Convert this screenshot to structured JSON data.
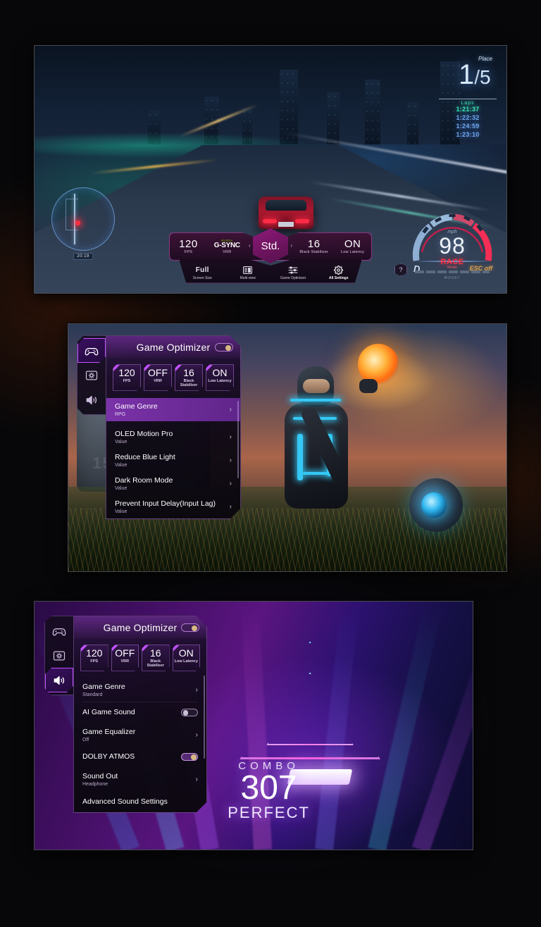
{
  "panels": {
    "racing": {
      "name": "Racing game with Game Bar HUD",
      "hud": {
        "place_label": "Place",
        "place_value": "1",
        "place_total": "5",
        "laps_label": "Laps",
        "lap_times": [
          "1:21:37",
          "1:22:32",
          "1:24:59",
          "1:23:10"
        ],
        "minimap_label": "20:19"
      },
      "speedometer": {
        "unit": "mph",
        "speed": "98",
        "mode_name": "RACE",
        "mode_sub": "Mode",
        "gear": "D",
        "esc": "ESC off",
        "boost_label": "BOOST"
      },
      "game_bar": {
        "stats": [
          {
            "value": "120",
            "label": "FPS"
          },
          {
            "value": "G-SYNC",
            "label": "VRR",
            "brand": "NVIDIA"
          },
          {
            "value": "16",
            "label": "Black Stabilizer"
          },
          {
            "value": "ON",
            "label": "Low Latency"
          }
        ],
        "center_mode": "Std.",
        "arrow_left": "‹",
        "arrow_right": "›",
        "actions": [
          {
            "icon": "screen-size-icon",
            "value": "Full",
            "label": "Screen Size"
          },
          {
            "icon": "multi-view-icon",
            "value": "",
            "label": "Multi-view"
          },
          {
            "icon": "sliders-icon",
            "value": "",
            "label": "Game Optimizer"
          },
          {
            "icon": "gear-icon",
            "value": "",
            "label": "All Settings"
          }
        ],
        "help": "?"
      }
    },
    "scifi": {
      "name": "Sci-fi game with Game Optimizer menu",
      "osd": {
        "title": "Game Optimizer",
        "rail": [
          {
            "icon": "gamepad-icon",
            "name": "game-tab",
            "active": true
          },
          {
            "icon": "picture-icon",
            "name": "picture-tab",
            "active": false
          },
          {
            "icon": "speaker-icon",
            "name": "sound-tab",
            "active": false
          }
        ],
        "chips": [
          {
            "value": "120",
            "label": "FPS"
          },
          {
            "value": "OFF",
            "label": "VRR"
          },
          {
            "value": "16",
            "label": "Black Stabilizer"
          },
          {
            "value": "ON",
            "label": "Low Latency"
          }
        ],
        "rows": [
          {
            "label": "Game Genre",
            "value": "RPG",
            "control": "chevron",
            "selected": true
          },
          {
            "label": "OLED Motion Pro",
            "value": "Value",
            "control": "chevron",
            "selected": false
          },
          {
            "label": "Reduce Blue Light",
            "value": "Value",
            "control": "chevron",
            "selected": false
          },
          {
            "label": "Dark Room Mode",
            "value": "Value",
            "control": "chevron",
            "selected": false
          },
          {
            "label": "Prevent Input Delay(Input Lag)",
            "value": "Value",
            "control": "chevron",
            "selected": false
          }
        ],
        "chevron": "›"
      }
    },
    "rhythm": {
      "name": "Rhythm game with Game Optimizer sound menu",
      "hud": {
        "combo_label": "COMBO",
        "combo_value": "307",
        "judgement": "PERFECT"
      },
      "osd": {
        "title": "Game Optimizer",
        "rail": [
          {
            "icon": "gamepad-icon",
            "name": "game-tab",
            "active": false
          },
          {
            "icon": "picture-icon",
            "name": "picture-tab",
            "active": false
          },
          {
            "icon": "speaker-icon",
            "name": "sound-tab",
            "active": true
          }
        ],
        "chips": [
          {
            "value": "120",
            "label": "FPS"
          },
          {
            "value": "OFF",
            "label": "VRR"
          },
          {
            "value": "16",
            "label": "Black Stabilizer"
          },
          {
            "value": "ON",
            "label": "Low Latency"
          }
        ],
        "rows": [
          {
            "label": "Game Genre",
            "value": "Standard",
            "control": "chevron",
            "selected": false
          },
          {
            "label": "AI Game Sound",
            "value": "",
            "control": "toggle",
            "toggle_on": false,
            "selected": false
          },
          {
            "label": "Game Equalizer",
            "value": "Off",
            "control": "chevron",
            "selected": false
          },
          {
            "label": "DOLBY ATMOS",
            "value": "",
            "control": "toggle",
            "toggle_on": true,
            "selected": false
          },
          {
            "label": "Sound Out",
            "value": "Headphone",
            "control": "chevron",
            "selected": false
          },
          {
            "label": "Advanced Sound Settings",
            "value": "",
            "control": "none",
            "selected": false
          }
        ],
        "chevron": "›"
      }
    }
  },
  "colors": {
    "accent_purple": "#c250ff",
    "accent_magenta": "#d65cc8",
    "background": "#070709",
    "nvidia_green": "#76b900",
    "gold_knob": "#d7b884",
    "race_red": "#ff3344",
    "cyan_neon": "#35c8f5"
  }
}
